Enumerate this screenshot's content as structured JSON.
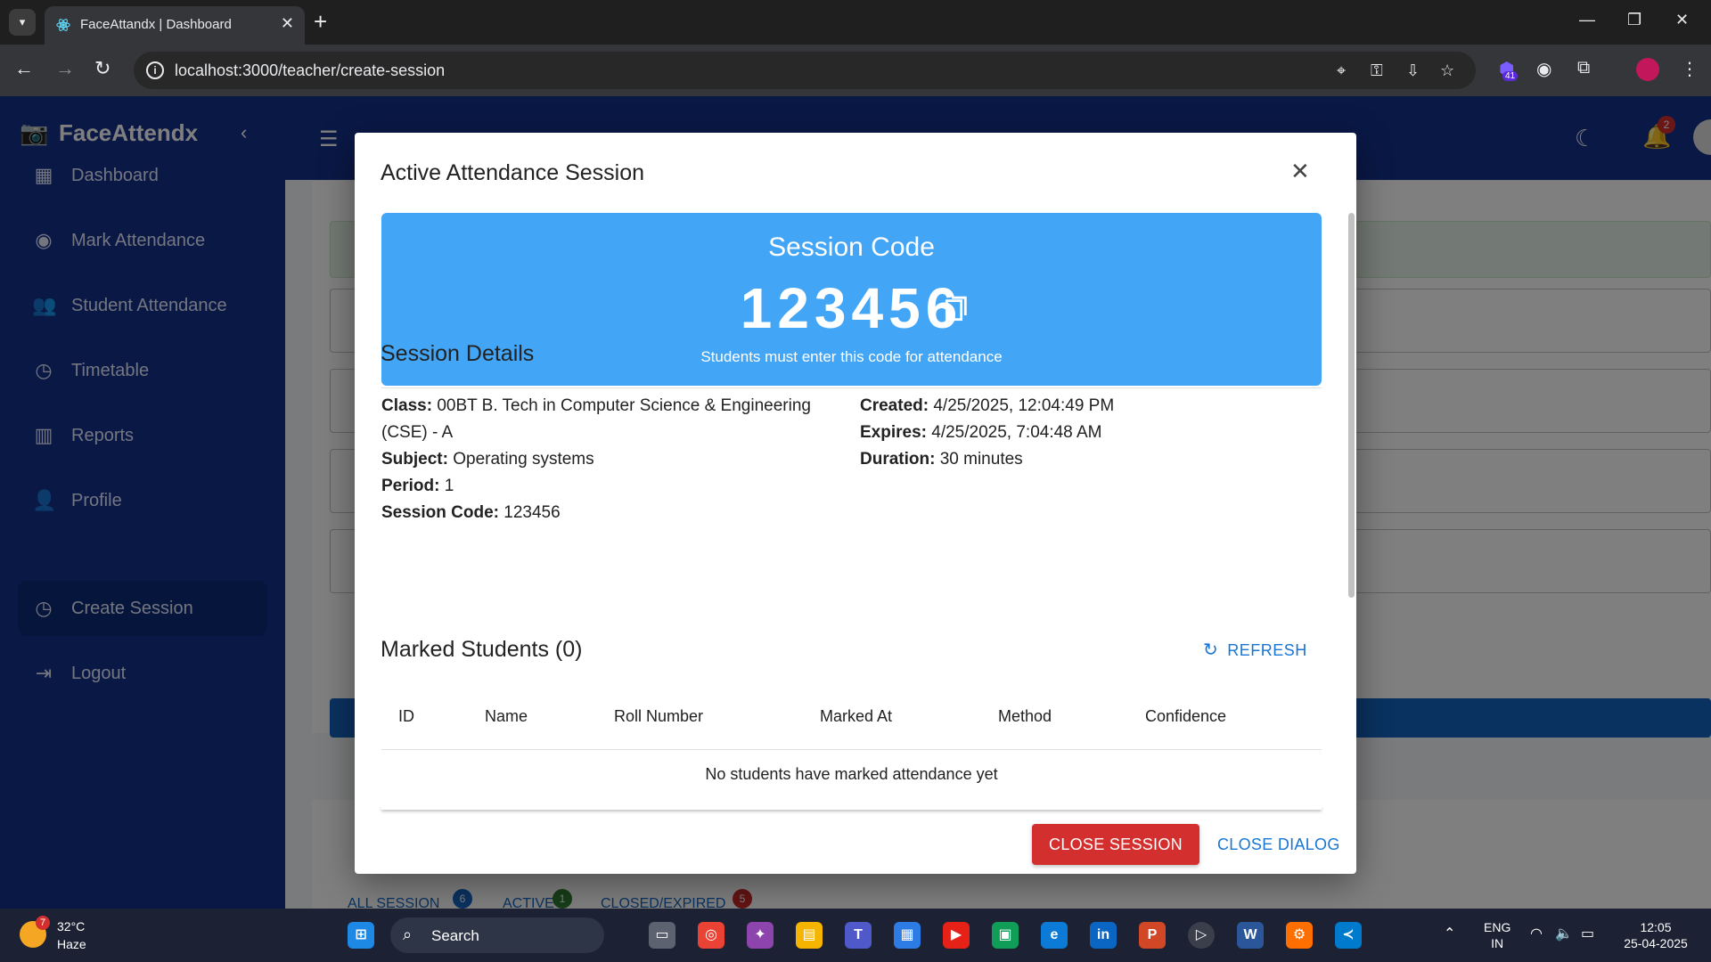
{
  "browser": {
    "tab_title": "FaceAttandx | Dashboard",
    "url": "localhost:3000/teacher/create-session",
    "extension_badge": "41"
  },
  "app": {
    "brand": "FaceAttendx",
    "nav": [
      {
        "label": "Dashboard",
        "icon": "dashboard-icon"
      },
      {
        "label": "Mark Attendance",
        "icon": "camera-icon"
      },
      {
        "label": "Student Attendance",
        "icon": "people-icon"
      },
      {
        "label": "Timetable",
        "icon": "clock-icon"
      },
      {
        "label": "Reports",
        "icon": "bar-chart-icon"
      },
      {
        "label": "Profile",
        "icon": "person-icon"
      },
      {
        "label": "Create Session",
        "icon": "clock-icon",
        "active": true
      },
      {
        "label": "Logout",
        "icon": "logout-icon"
      }
    ],
    "notification_count": "2",
    "background_tabs": [
      {
        "label": "ALL SESSION",
        "count": "6",
        "color": "#1565c0"
      },
      {
        "label": "ACTIVE",
        "count": "1",
        "color": "#2e7d32"
      },
      {
        "label": "CLOSED/EXPIRED",
        "count": "5",
        "color": "#c62828"
      }
    ]
  },
  "dialog": {
    "title": "Active Attendance Session",
    "code_label": "Session Code",
    "code": "123456",
    "code_hint": "Students must enter this code for attendance",
    "details_title": "Session Details",
    "details_left": [
      {
        "key": "Class:",
        "value": "00BT B. Tech in Computer Science & Engineering"
      },
      {
        "key": "",
        "value": "(CSE) - A"
      },
      {
        "key": "Subject:",
        "value": "Operating systems"
      },
      {
        "key": "Period:",
        "value": "1"
      },
      {
        "key": "Session Code:",
        "value": "123456"
      }
    ],
    "details_right": [
      {
        "key": "Created:",
        "value": "4/25/2025, 12:04:49 PM"
      },
      {
        "key": "Expires:",
        "value": "4/25/2025, 7:04:48 AM"
      },
      {
        "key": "Duration:",
        "value": "30 minutes"
      }
    ],
    "marked_title": "Marked Students (0)",
    "refresh_label": "REFRESH",
    "table_headers": [
      "ID",
      "Name",
      "Roll Number",
      "Marked At",
      "Method",
      "Confidence"
    ],
    "empty_text": "No students have marked attendance yet",
    "close_session_label": "CLOSE SESSION",
    "close_dialog_label": "CLOSE DIALOG"
  },
  "taskbar": {
    "temperature": "32°C",
    "condition": "Haze",
    "weather_badge": "7",
    "search_label": "Search",
    "lang_line1": "ENG",
    "lang_line2": "IN",
    "time": "12:05",
    "date": "25-04-2025"
  }
}
